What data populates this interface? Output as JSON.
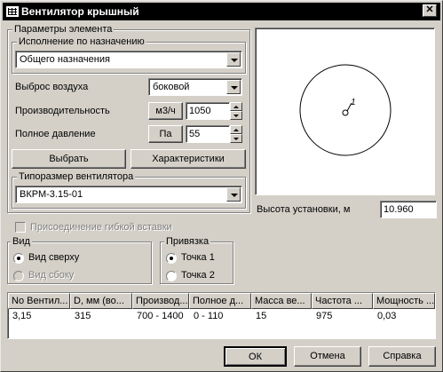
{
  "window": {
    "title": "Вентилятор крышный"
  },
  "params": {
    "group_title": "Параметры элемента",
    "purpose_group_title": "Исполнение по назначению",
    "purpose_value": "Общего назначения",
    "air_discharge_label": "Выброс воздуха",
    "air_discharge_value": "боковой",
    "capacity_label": "Производительность",
    "capacity_unit": "м3/ч",
    "capacity_value": "1050",
    "pressure_label": "Полное давление",
    "pressure_unit": "Па",
    "pressure_value": "55",
    "select_button": "Выбрать",
    "characteristics_button": "Характеристики",
    "size_group_title": "Типоразмер вентилятора",
    "size_value": "ВКРМ-3.15-01"
  },
  "preview": {
    "label": "1"
  },
  "height": {
    "label": "Высота установки, м",
    "value": "10.960"
  },
  "flex_insert": {
    "label": "Присоединение гибкой вставки"
  },
  "view": {
    "title": "Вид",
    "top": "Вид сверху",
    "side": "Вид сбоку"
  },
  "anchor": {
    "title": "Привязка",
    "point1": "Точка 1",
    "point2": "Точка 2"
  },
  "table": {
    "columns": [
      "No Вентил...",
      "D, мм (во...",
      "Производ...",
      "Полное д...",
      "Масса ве...",
      "Частота ...",
      "Мощность ..."
    ],
    "rows": [
      [
        "3,15",
        "315",
        "700 - 1400",
        "0 - 110",
        "15",
        "975",
        "0,03"
      ]
    ]
  },
  "buttons": {
    "ok": "ОК",
    "cancel": "Отмена",
    "help": "Справка"
  }
}
